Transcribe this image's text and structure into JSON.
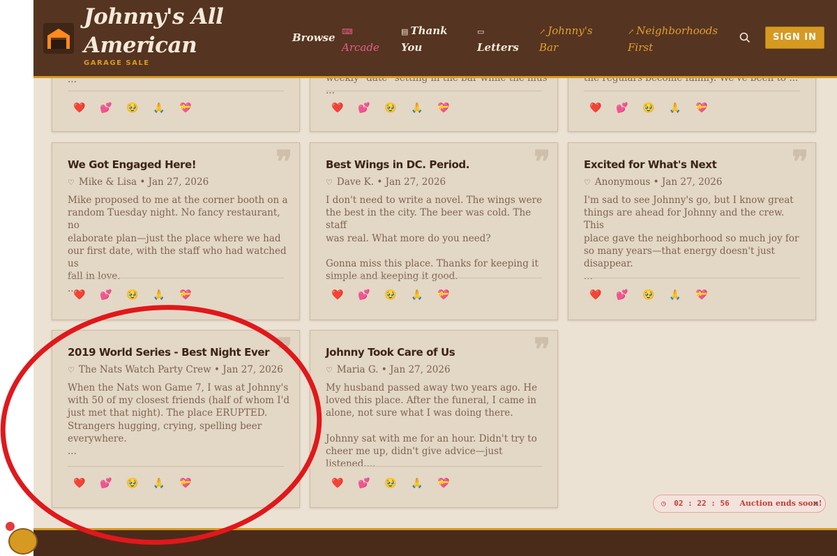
{
  "header": {
    "brand_line1": "Johnny's All",
    "brand_line2": "American",
    "brand_sub": "GARAGE SALE",
    "nav": {
      "browse": "Browse",
      "arcade": "Arcade",
      "thank_line1": "Thank",
      "thank_line2": "You",
      "letters": "Letters",
      "bar_line1": "Johnny's",
      "bar_line2": "Bar",
      "neigh_line1": "Neighborhoods",
      "neigh_line2": "First"
    },
    "sign_in": "SIGN IN"
  },
  "partial_cards": {
    "first_text": "...",
    "second_text": "weekly \"date\" setting in the bar while the mus ...",
    "third_text": "the regulars become family. We've been to ..."
  },
  "cards": [
    {
      "title": "We Got Engaged Here!",
      "author": "Mike & Lisa",
      "date": "Jan 27, 2026",
      "body": "Mike proposed to me at the corner booth on a\nrandom Tuesday night. No fancy restaurant, no\nelaborate plan—just the place where we had\nour first date, with the staff who had watched us\nfall in love.\n..."
    },
    {
      "title": "Best Wings in DC. Period.",
      "author": "Dave K.",
      "date": "Jan 27, 2026",
      "body": "I don't need to write a novel. The wings were\nthe best in the city. The beer was cold. The staff\nwas real. What more do you need?\n\nGonna miss this place. Thanks for keeping it\nsimple and keeping it good."
    },
    {
      "title": "Excited for What's Next",
      "author": "Anonymous",
      "date": "Jan 27, 2026",
      "body": "I'm sad to see Johnny's go, but I know great\nthings are ahead for Johnny and the crew. This\nplace gave the neighborhood so much joy for\nso many years—that energy doesn't just\ndisappear.\n..."
    },
    {
      "title": "2019 World Series - Best Night Ever",
      "author": "The Nats Watch Party Crew",
      "date": "Jan 27, 2026",
      "body": "When the Nats won Game 7, I was at Johnny's\nwith 50 of my closest friends (half of whom I'd\njust met that night). The place ERUPTED.\nStrangers hugging, crying, spelling beer\neverywhere.\n..."
    },
    {
      "title": "Johnny Took Care of Us",
      "author": "Maria G.",
      "date": "Jan 27, 2026",
      "body": "My husband passed away two years ago. He\nloved this place. After the funeral, I came in\nalone, not sure what I was doing there.\n\nJohnny sat with me for an hour. Didn't try to\ncheer me up, didn't give advice—just listened...."
    }
  ],
  "reactions": [
    "❤️",
    "💕",
    "🥹",
    "🙏",
    "💝"
  ],
  "toast": {
    "timer": "02 : 22 : 56",
    "message": "Auction ends soon!",
    "close": "×"
  },
  "colors": {
    "header_bg": "#553421",
    "accent_gold": "#d69a22",
    "arcade_pink": "#e85f84",
    "page_bg": "#ece2d4",
    "card_bg": "#e3d7c5",
    "annotation_red": "#e0181b"
  },
  "icons": {
    "logo": "garage-icon",
    "search": "search-icon",
    "arcade": "gamepad-icon",
    "thank": "document-icon",
    "letters": "message-icon",
    "external": "external-link-icon",
    "author": "heart-outline-icon",
    "timer": "clock-icon"
  }
}
